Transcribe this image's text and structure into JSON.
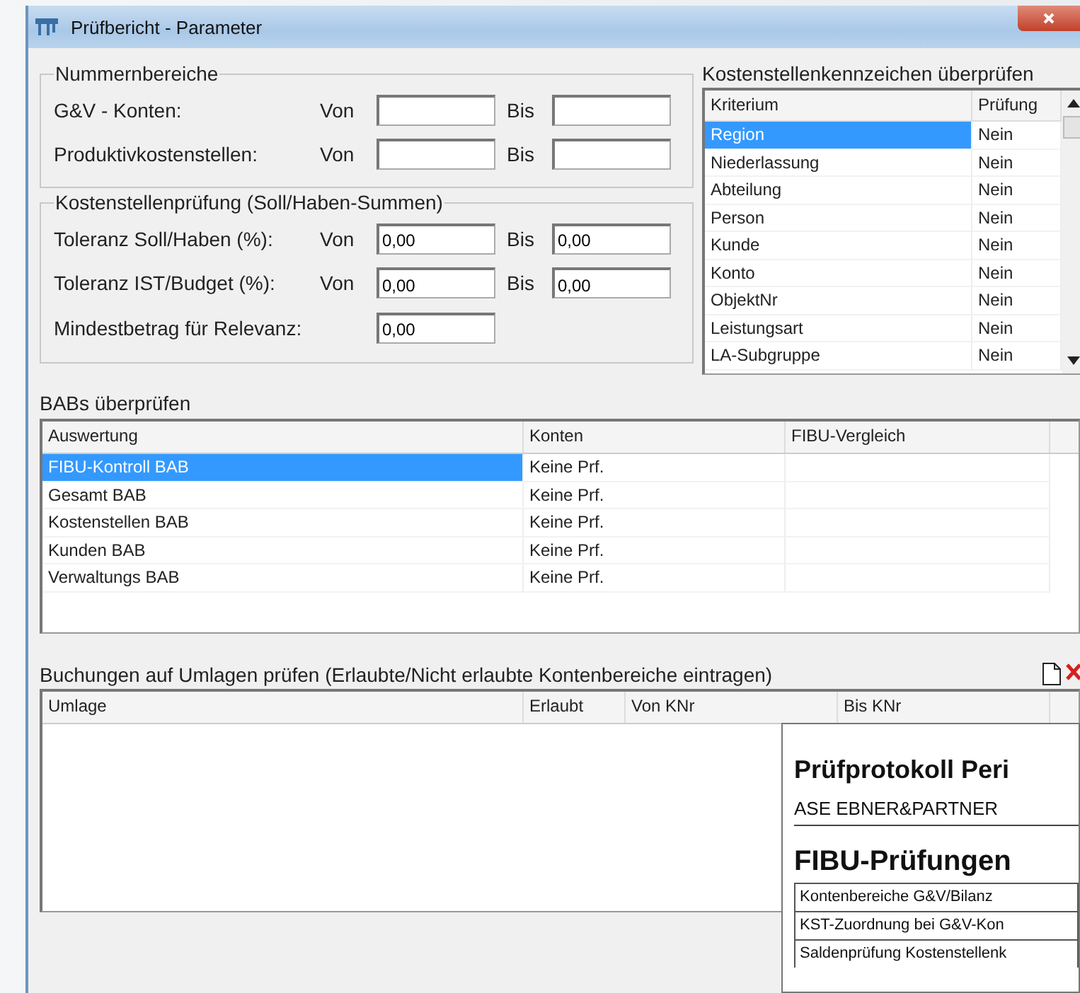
{
  "window": {
    "title": "Prüfbericht - Parameter"
  },
  "number_ranges": {
    "title": "Nummernbereiche",
    "rows": [
      {
        "label": "G&V - Konten:",
        "from_label": "Von",
        "to_label": "Bis"
      },
      {
        "label": "Produktivkostenstellen:",
        "from_label": "Von",
        "to_label": "Bis"
      }
    ]
  },
  "cost_center_check": {
    "title": "Kostenstellenprüfung (Soll/Haben-Summen)",
    "rows": [
      {
        "label": "Toleranz Soll/Haben (%):",
        "from_label": "Von",
        "from_value": "0,00",
        "to_label": "Bis",
        "to_value": "0,00"
      },
      {
        "label": "Toleranz IST/Budget (%):",
        "from_label": "Von",
        "from_value": "0,00",
        "to_label": "Bis",
        "to_value": "0,00"
      },
      {
        "label": "Mindestbetrag für Relevanz:",
        "from_value": "0,00"
      }
    ]
  },
  "criteria": {
    "title": "Kostenstellenkennzeichen überprüfen",
    "columns": [
      "Kriterium",
      "Prüfung"
    ],
    "rows": [
      {
        "criterion": "Region",
        "check": "Nein",
        "selected": true
      },
      {
        "criterion": "Niederlassung",
        "check": "Nein",
        "selected": false
      },
      {
        "criterion": "Abteilung",
        "check": "Nein",
        "selected": false
      },
      {
        "criterion": "Person",
        "check": "Nein",
        "selected": false
      },
      {
        "criterion": "Kunde",
        "check": "Nein",
        "selected": false
      },
      {
        "criterion": "Konto",
        "check": "Nein",
        "selected": false
      },
      {
        "criterion": "ObjektNr",
        "check": "Nein",
        "selected": false
      },
      {
        "criterion": "Leistungsart",
        "check": "Nein",
        "selected": false
      },
      {
        "criterion": "LA-Subgruppe",
        "check": "Nein",
        "selected": false
      }
    ]
  },
  "babs": {
    "title": "BABs überprüfen",
    "columns": [
      "Auswertung",
      "Konten",
      "FIBU-Vergleich"
    ],
    "rows": [
      {
        "evaluation": "FIBU-Kontroll BAB",
        "accounts": "Keine Prf.",
        "selected": true
      },
      {
        "evaluation": "Gesamt BAB",
        "accounts": "Keine Prf.",
        "selected": false
      },
      {
        "evaluation": "Kostenstellen BAB",
        "accounts": "Keine Prf.",
        "selected": false
      },
      {
        "evaluation": "Kunden BAB",
        "accounts": "Keine Prf.",
        "selected": false
      },
      {
        "evaluation": "Verwaltungs BAB",
        "accounts": "Keine Prf.",
        "selected": false
      }
    ]
  },
  "allocations": {
    "title": "Buchungen auf Umlagen prüfen (Erlaubte/Nicht erlaubte Kontenbereiche eintragen)",
    "columns": [
      "Umlage",
      "Erlaubt",
      "Von KNr",
      "Bis KNr"
    ]
  },
  "report_preview": {
    "title": "Prüfprotokoll Peri",
    "company": "ASE EBNER&PARTNER",
    "section": "FIBU-Prüfungen",
    "rows": [
      "Kontenbereiche G&V/Bilanz",
      "KST-Zuordnung bei G&V-Kon",
      "Saldenprüfung Kostenstellenk"
    ]
  }
}
